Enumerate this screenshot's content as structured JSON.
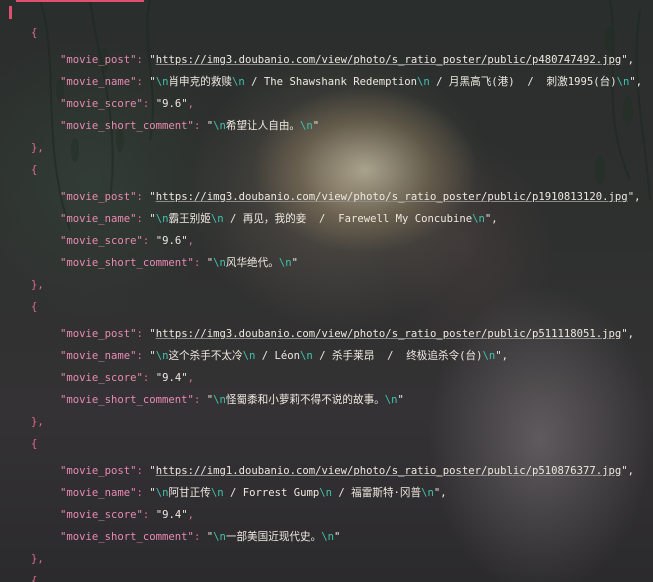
{
  "editor": {
    "open_brace": "{",
    "close_brace": "},",
    "records": [
      {
        "post_key": "\"movie_post\"",
        "post_url": "https://img3.doubanio.com/view/photo/s_ratio_poster/public/p480747492.jpg",
        "post_tail": "\",",
        "name_key": "\"movie_name\"",
        "name_segs": [
          "肖申克的救赎",
          " / The Shawshank Redemption",
          " / 月黑高飞(港)  /  刺激1995(台)"
        ],
        "name_tail": "\",",
        "score_key": "\"movie_score\"",
        "score_val": "\"9.6\"",
        "comment_key": "\"movie_short_comment\"",
        "comment_text": "希望让人自由。"
      },
      {
        "post_key": "\"movie_post\"",
        "post_url": "https://img3.doubanio.com/view/photo/s_ratio_poster/public/p1910813120.jpg",
        "post_tail": "\",",
        "name_key": "\"movie_name\"",
        "name_segs": [
          "霸王别姬",
          " / 再见，我的妾  /  Farewell My Concubine"
        ],
        "name_tail": "\",",
        "score_key": "\"movie_score\"",
        "score_val": "\"9.6\"",
        "comment_key": "\"movie_short_comment\"",
        "comment_text": "风华绝代。"
      },
      {
        "post_key": "\"movie_post\"",
        "post_url": "https://img3.doubanio.com/view/photo/s_ratio_poster/public/p511118051.jpg",
        "post_tail": "\",",
        "name_key": "\"movie_name\"",
        "name_segs": [
          "这个杀手不太冷",
          " / Léon",
          " / 杀手莱昂  /  终极追杀令(台)"
        ],
        "name_tail": "\",",
        "score_key": "\"movie_score\"",
        "score_val": "\"9.4\"",
        "comment_key": "\"movie_short_comment\"",
        "comment_text": "怪蜀黍和小萝莉不得不说的故事。"
      },
      {
        "post_key": "\"movie_post\"",
        "post_url": "https://img1.doubanio.com/view/photo/s_ratio_poster/public/p510876377.jpg",
        "post_tail": "\",",
        "name_key": "\"movie_name\"",
        "name_segs": [
          "阿甘正传",
          " / Forrest Gump",
          " / 福雷斯特·冈普"
        ],
        "name_tail": "\",",
        "score_key": "\"movie_score\"",
        "score_val": "\"9.4\"",
        "comment_key": "\"movie_short_comment\"",
        "comment_text": "一部美国近现代史。"
      }
    ],
    "escape_seq": "\\n",
    "colon": ": ",
    "quote": "\"",
    "comma": ",",
    "open_bracket": "["
  },
  "colors": {
    "punctuation": "#e06c8c",
    "key": "#e98ab0",
    "string": "#eee8e0",
    "escape": "#3fc3ae",
    "cursor": "#e0506e"
  }
}
